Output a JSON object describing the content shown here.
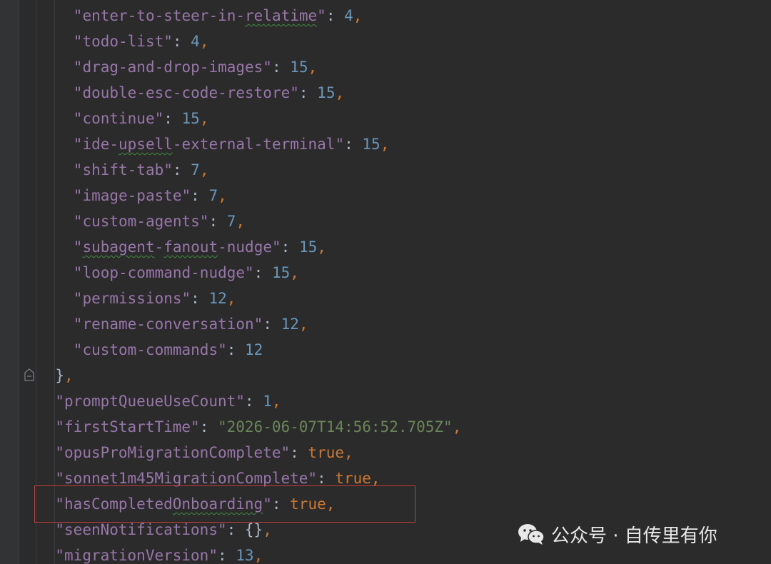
{
  "editor": {
    "lines": [
      {
        "indent": 4,
        "key": "\"enter-to-steer-in-relatime\"",
        "value": "4",
        "vtype": "number",
        "trail": ","
      },
      {
        "indent": 4,
        "key": "\"todo-list\"",
        "value": "4",
        "vtype": "number",
        "trail": ","
      },
      {
        "indent": 4,
        "key": "\"drag-and-drop-images\"",
        "value": "15",
        "vtype": "number",
        "trail": ","
      },
      {
        "indent": 4,
        "key": "\"double-esc-code-restore\"",
        "value": "15",
        "vtype": "number",
        "trail": ","
      },
      {
        "indent": 4,
        "key": "\"continue\"",
        "value": "15",
        "vtype": "number",
        "trail": ","
      },
      {
        "indent": 4,
        "key": "\"ide-upsell-external-terminal\"",
        "value": "15",
        "vtype": "number",
        "trail": ","
      },
      {
        "indent": 4,
        "key": "\"shift-tab\"",
        "value": "7",
        "vtype": "number",
        "trail": ","
      },
      {
        "indent": 4,
        "key": "\"image-paste\"",
        "value": "7",
        "vtype": "number",
        "trail": ","
      },
      {
        "indent": 4,
        "key": "\"custom-agents\"",
        "value": "7",
        "vtype": "number",
        "trail": ","
      },
      {
        "indent": 4,
        "key": "\"subagent-fanout-nudge\"",
        "value": "15",
        "vtype": "number",
        "trail": ","
      },
      {
        "indent": 4,
        "key": "\"loop-command-nudge\"",
        "value": "15",
        "vtype": "number",
        "trail": ","
      },
      {
        "indent": 4,
        "key": "\"permissions\"",
        "value": "12",
        "vtype": "number",
        "trail": ","
      },
      {
        "indent": 4,
        "key": "\"rename-conversation\"",
        "value": "12",
        "vtype": "number",
        "trail": ","
      },
      {
        "indent": 4,
        "key": "\"custom-commands\"",
        "value": "12",
        "vtype": "number",
        "trail": ""
      },
      {
        "indent": 2,
        "key": "",
        "value": "}",
        "vtype": "plain",
        "trail": ","
      },
      {
        "indent": 2,
        "key": "\"promptQueueUseCount\"",
        "value": "1",
        "vtype": "number",
        "trail": ","
      },
      {
        "indent": 2,
        "key": "\"firstStartTime\"",
        "value": "\"2026-06-07T14:56:52.705Z\"",
        "vtype": "string",
        "trail": ","
      },
      {
        "indent": 2,
        "key": "\"opusProMigrationComplete\"",
        "value": "true",
        "vtype": "bool",
        "trail": ","
      },
      {
        "indent": 2,
        "key": "\"sonnet1m45MigrationComplete\"",
        "value": "true",
        "vtype": "bool",
        "trail": ","
      },
      {
        "indent": 2,
        "key": "\"hasCompletedOnboarding\"",
        "value": "true",
        "vtype": "bool",
        "trail": ","
      },
      {
        "indent": 2,
        "key": "\"seenNotifications\"",
        "value": "{}",
        "vtype": "plain",
        "trail": ","
      },
      {
        "indent": 2,
        "key": "\"migrationVersion\"",
        "value": "13",
        "vtype": "number",
        "trail": ","
      }
    ],
    "squiggles": [
      "relatime",
      "upsell",
      "subagent",
      "fanout",
      "Onboarding"
    ]
  },
  "watermark": {
    "label": "公众号 · 自传里有你",
    "icon": "wechat-icon"
  },
  "colors": {
    "background": "#2b2b2b",
    "key": "#9876aa",
    "number": "#6897bb",
    "string": "#6a8759",
    "keyword": "#cc7832",
    "highlight": "#c43c3c"
  }
}
